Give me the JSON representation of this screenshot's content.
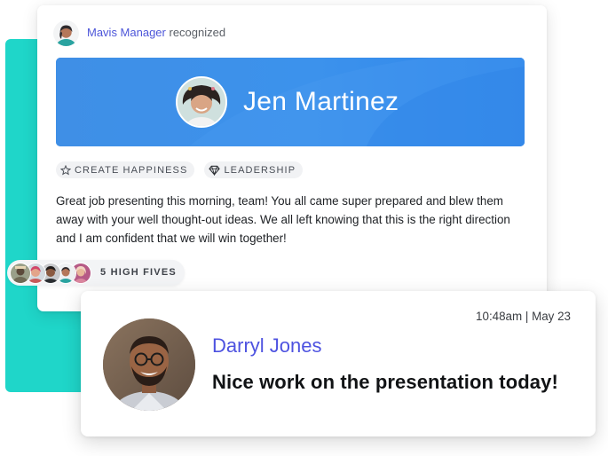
{
  "colors": {
    "accent_teal": "#1fd6c9",
    "hero_blue": "#3d90ea",
    "link_indigo": "#4c55d9",
    "name_indigo": "#4d52e0"
  },
  "recognition": {
    "recognizer": {
      "name": "Mavis Manager",
      "action": "recognized",
      "avatar_icon": "avatar-photo"
    },
    "recipient": {
      "name": "Jen Martinez",
      "avatar_icon": "avatar-photo"
    },
    "tags": [
      {
        "icon": "star-icon",
        "label": "CREATE HAPPINESS"
      },
      {
        "icon": "diamond-icon",
        "label": "LEADERSHIP"
      }
    ],
    "message": "Great job presenting this morning, team! You all came super prepared and blew them away with your well thought-out ideas. We all left knowing that this is the right direction and I am confident that we will win together!",
    "high_fives": {
      "label": "5 HIGH FIVES",
      "count": 5
    }
  },
  "comment": {
    "author": "Darryl Jones",
    "timestamp": "10:48am | May 23",
    "text": "Nice work on the presentation today!",
    "avatar_icon": "avatar-photo"
  }
}
